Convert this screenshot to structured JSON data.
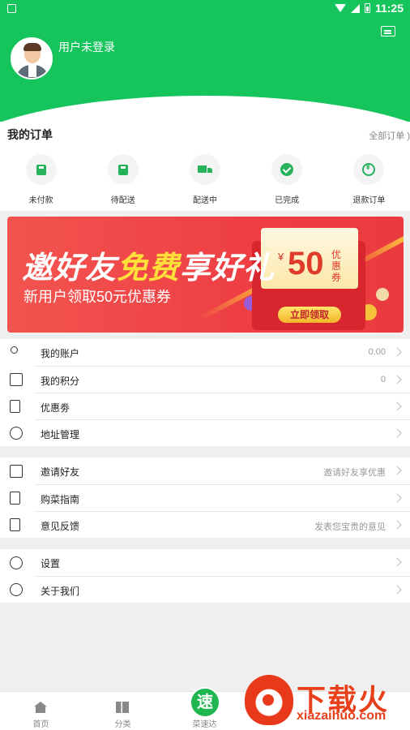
{
  "status_bar": {
    "time": "11:25"
  },
  "header": {
    "login_text": "用户未登录"
  },
  "orders": {
    "title": "我的订单",
    "all_link": "全部订单 )",
    "items": [
      {
        "label": "未付款",
        "icon": "bag-icon"
      },
      {
        "label": "待配送",
        "icon": "bag-icon"
      },
      {
        "label": "配送中",
        "icon": "truck-icon"
      },
      {
        "label": "已完成",
        "icon": "check-icon"
      },
      {
        "label": "退款订单",
        "icon": "refund-icon"
      }
    ]
  },
  "banner": {
    "title_pre": "邀好友",
    "title_hl": "免费",
    "title_post": "享好礼",
    "subtitle": "新用户领取50元优惠券",
    "coupon_yen": "¥",
    "coupon_amount": "50",
    "coupon_desc": "优惠券",
    "cta": "立即领取"
  },
  "menu_group_1": [
    {
      "label": "我的账户",
      "value": "0.00",
      "icon": "account-icon"
    },
    {
      "label": "我的积分",
      "value": "0",
      "icon": "points-icon"
    },
    {
      "label": "优惠劵",
      "value": "",
      "icon": "coupon-icon"
    },
    {
      "label": "地址管理",
      "value": "",
      "icon": "location-icon"
    }
  ],
  "menu_group_2": [
    {
      "label": "邀请好友",
      "value": "邀请好友享优惠",
      "icon": "gift-icon"
    },
    {
      "label": "购菜指南",
      "value": "",
      "icon": "guide-icon"
    },
    {
      "label": "意见反馈",
      "value": "发表您宝贵的意见",
      "icon": "feedback-icon"
    }
  ],
  "menu_group_3": [
    {
      "label": "设置",
      "value": "",
      "icon": "settings-icon"
    },
    {
      "label": "关于我们",
      "value": "",
      "icon": "info-icon"
    }
  ],
  "bottom_nav": {
    "home": "首页",
    "category": "分类",
    "speed_char": "速",
    "speed_label": "菜速达"
  },
  "watermark": {
    "text": "下载火",
    "url": "xiazaihuo.com"
  },
  "colors": {
    "brand_green": "#16c45c",
    "banner_red": "#ee3f44",
    "accent_yellow": "#ffdf3a"
  }
}
